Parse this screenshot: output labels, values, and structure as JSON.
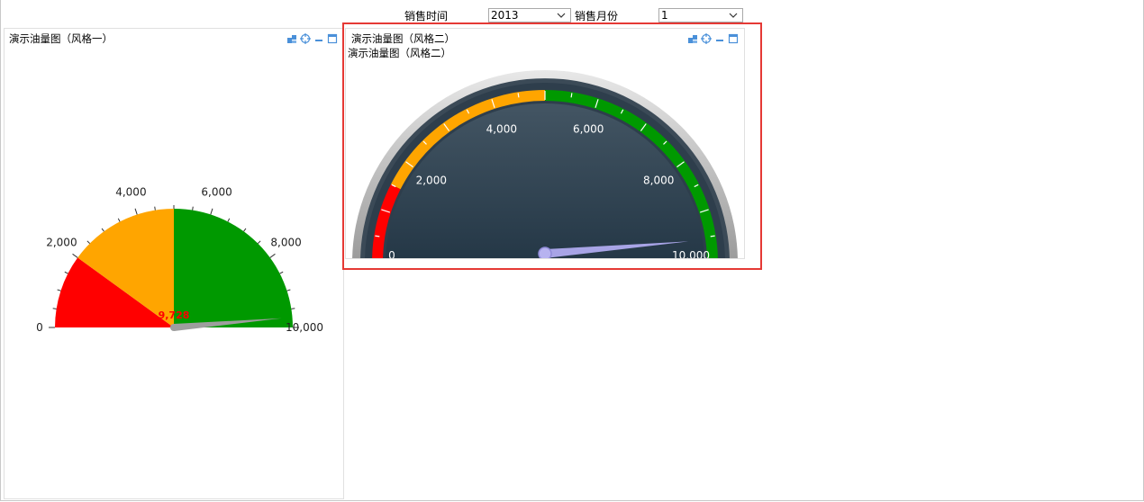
{
  "filters": {
    "time_label": "销售时间",
    "time_value": "2013",
    "month_label": "销售月份",
    "month_value": "1"
  },
  "panels": {
    "left": {
      "title": "演示油量图（风格一）"
    },
    "right": {
      "title": "演示油量图（风格二）",
      "subtitle": "演示油量图（风格二）"
    }
  },
  "icons": [
    "export-icon",
    "locate-icon",
    "minimize-icon",
    "maximize-icon"
  ],
  "colors": {
    "red": "#ff0000",
    "orange": "#ffa500",
    "green": "#009900",
    "needle_left": "#9e9e9e",
    "needle_right": "#a8a4e6",
    "highlight": "#e53935"
  },
  "chart_data": [
    {
      "type": "gauge",
      "style": "semicircle-flat",
      "min": 0,
      "max": 10000,
      "value": 9728,
      "value_label": "9,728",
      "bands": [
        {
          "from": 0,
          "to": 2000,
          "color": "#ff0000"
        },
        {
          "from": 2000,
          "to": 5000,
          "color": "#ffa500"
        },
        {
          "from": 5000,
          "to": 10000,
          "color": "#009900"
        }
      ],
      "tick_labels": [
        "0",
        "2,000",
        "4,000",
        "6,000",
        "8,000",
        "10,000"
      ]
    },
    {
      "type": "gauge",
      "style": "semicircle-dark",
      "min": 0,
      "max": 10000,
      "value": 9728,
      "bands": [
        {
          "from": 0,
          "to": 1500,
          "color": "#ff0000"
        },
        {
          "from": 1500,
          "to": 5000,
          "color": "#ffa500"
        },
        {
          "from": 5000,
          "to": 10000,
          "color": "#009900"
        }
      ],
      "tick_labels": [
        "0",
        "2,000",
        "4,000",
        "6,000",
        "8,000",
        "10,000"
      ]
    }
  ]
}
